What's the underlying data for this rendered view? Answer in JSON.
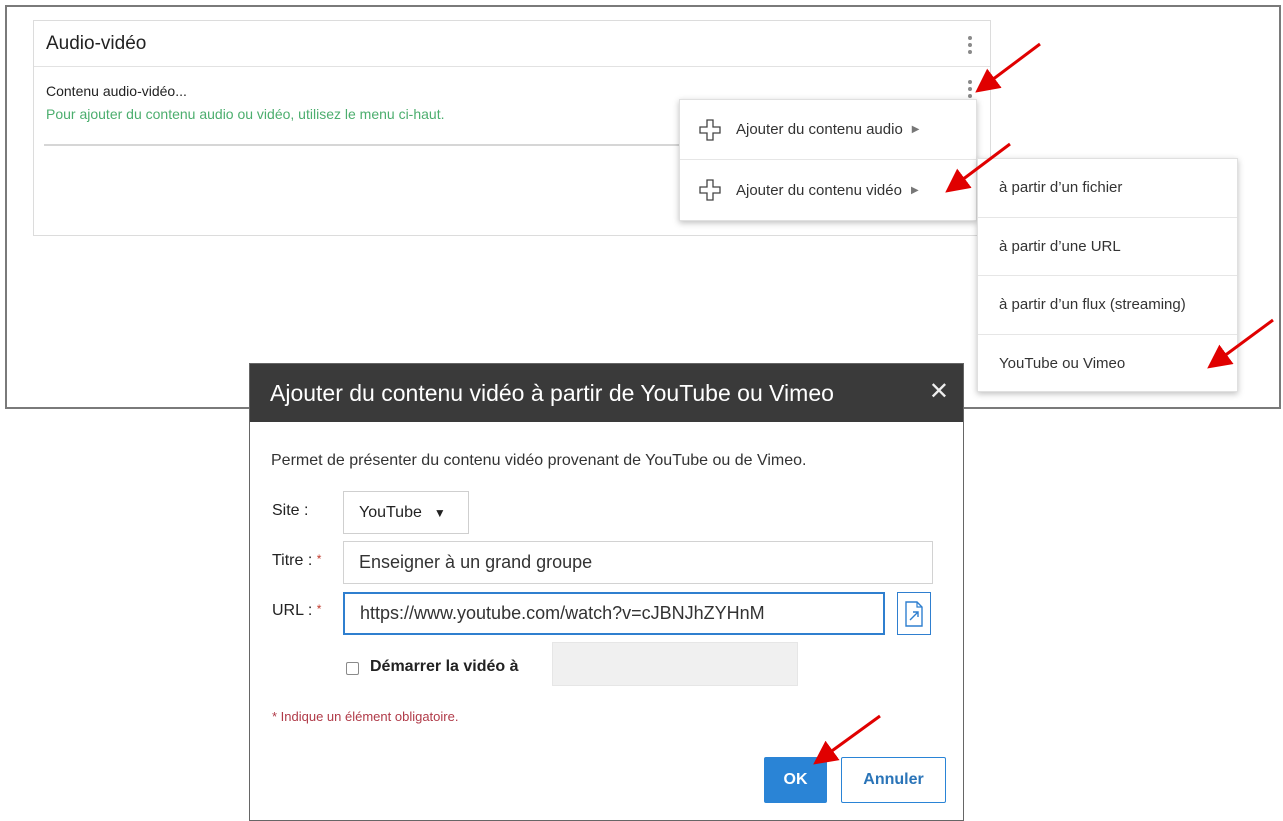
{
  "panel": {
    "title": "Audio-vidéo",
    "content_title": "Contenu audio-vidéo...",
    "content_hint": "Pour ajouter du contenu audio ou vidéo, utilisez le menu ci-haut."
  },
  "menu": {
    "items": [
      {
        "label": "Ajouter du contenu audio",
        "icon": "plus-outline-icon"
      },
      {
        "label": "Ajouter du contenu vidéo",
        "icon": "plus-outline-icon"
      }
    ]
  },
  "submenu": {
    "items": [
      {
        "label": "à partir d’un fichier"
      },
      {
        "label": "à partir d’une URL"
      },
      {
        "label": "à partir d’un flux (streaming)"
      },
      {
        "label": "YouTube ou Vimeo"
      }
    ]
  },
  "dialog": {
    "title": "Ajouter du contenu vidéo à partir de YouTube ou Vimeo",
    "close_symbol": "✕",
    "description": "Permet de présenter du contenu vidéo provenant de YouTube ou de Vimeo.",
    "site_label": "Site :",
    "site_value": "YouTube",
    "title_label": "Titre :",
    "title_value": "Enseigner à un grand groupe",
    "url_label": "URL :",
    "url_value": "https://www.youtube.com/watch?v=cJBNJhZYHnM",
    "required_marker": "*",
    "start_label": "Démarrer la vidéo à",
    "start_value": "",
    "required_note": "* Indique un élément obligatoire.",
    "ok_label": "OK",
    "cancel_label": "Annuler"
  },
  "colors": {
    "accent": "#2a84d6",
    "hint_green": "#4cae6e",
    "required_red": "#b03a48",
    "dialog_header": "#3a3a3a",
    "annotation_arrow": "#e00000"
  }
}
